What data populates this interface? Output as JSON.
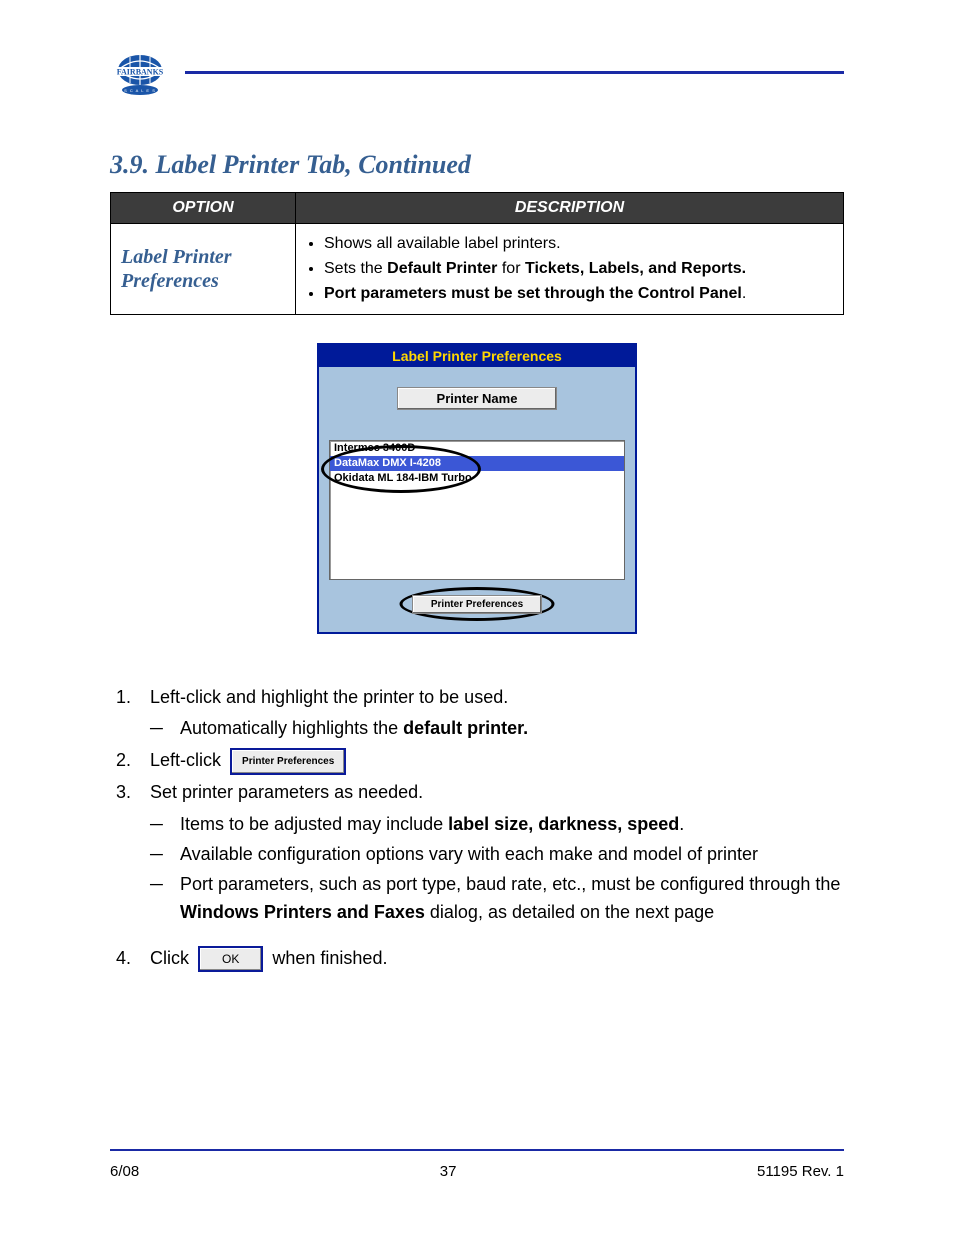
{
  "section_heading": "3.9. Label Printer Tab, Continued",
  "table": {
    "head_option": "OPTION",
    "head_desc": "DESCRIPTION",
    "row_label_line1": "Label Printer",
    "row_label_line2": "Preferences",
    "bullets": {
      "b1": "Shows all available label printers.",
      "b2_a": "Sets the ",
      "b2_b": "Default Printer ",
      "b2_c": "for ",
      "b2_d": "Tickets, Labels, and Reports.",
      "b3_a": "Port parameters must be set through the ",
      "b3_b": "Control Panel",
      "b3_c": "."
    }
  },
  "dialog": {
    "title": "Label Printer Preferences",
    "header_btn": "Printer Name",
    "rows": {
      "r0": "Intermec 3400D",
      "r1": "DataMax DMX I-4208",
      "r2": "Okidata ML 184-IBM Turbo"
    },
    "pref_btn": "Printer Preferences"
  },
  "inline": {
    "pref": "Printer Preferences",
    "ok": "OK"
  },
  "steps": {
    "s1": "Left-click and highlight the printer to be used.",
    "s1a_a": "Automatically highlights the ",
    "s1a_b": "default printer.",
    "s2": "Left-click",
    "s3": "Set printer parameters as needed.",
    "s3a_a": "Items to be adjusted may include ",
    "s3a_b": "label size, darkness, speed",
    "s3a_c": ".",
    "s3b": "Available configuration options vary with each make and model of printer",
    "s3c_a": "Port parameters, such as port type, baud rate, etc., must be configured through the ",
    "s3c_b": "Windows Printers and Faxes ",
    "s3c_c": "dialog, as detailed on the next page",
    "s4_a": "Click",
    "s4_b": "when finished."
  },
  "footer": {
    "left": "6/08",
    "center": "37",
    "right": "51195    Rev. 1"
  },
  "logo_text": "FAIRBANKS"
}
